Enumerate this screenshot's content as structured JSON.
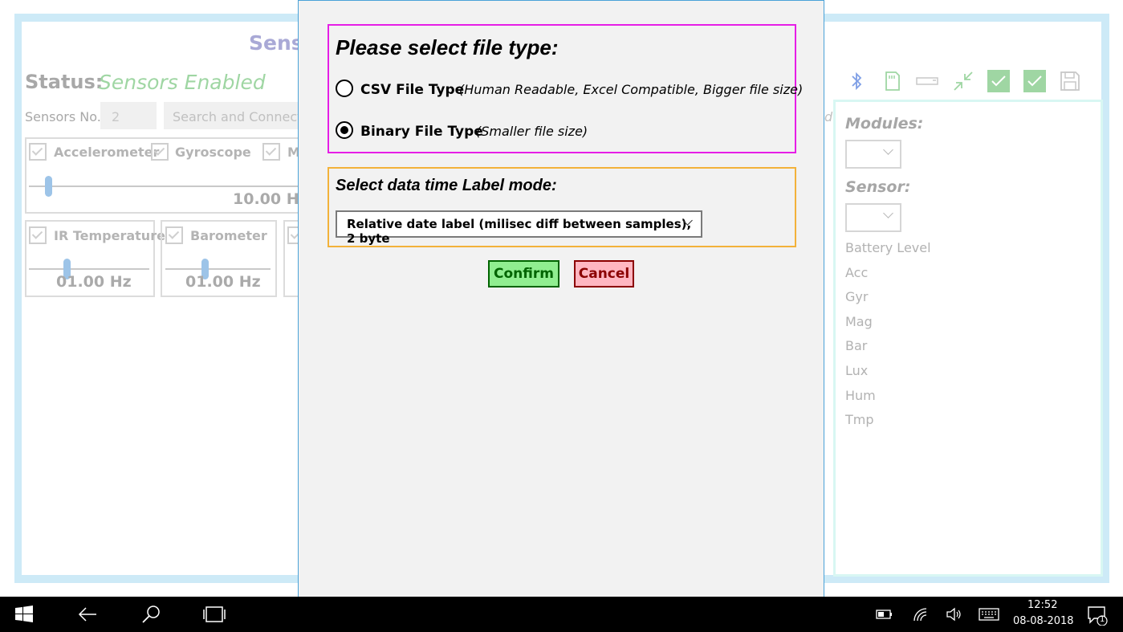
{
  "background": {
    "title_fragment": "Sens",
    "status_label": "Status:",
    "status_value": "Sensors Enabled",
    "sensors_no_label": "Sensors No.",
    "sensors_no_value": "2",
    "search_placeholder": "Search and Connect",
    "partial_d": "d",
    "group1": {
      "items": [
        {
          "label": "Accelerometer"
        },
        {
          "label": "Gyroscope"
        },
        {
          "label": "M"
        }
      ],
      "hz": "10.00 Hz"
    },
    "ir_card": {
      "label": "IR Temperature",
      "hz": "01.00 Hz"
    },
    "baro_card": {
      "label": "Barometer",
      "hz": "01.00 Hz"
    }
  },
  "side_panel": {
    "modules_label": "Modules:",
    "sensor_label": "Sensor:",
    "items": [
      "Battery Level",
      "Acc",
      "Gyr",
      "Mag",
      "Bar",
      "Lux",
      "Hum",
      "Tmp"
    ]
  },
  "toolbar_icons": [
    "bluetooth-icon",
    "sd-card-icon",
    "bar-icon",
    "collapse-icon",
    "check-icon",
    "check-icon",
    "save-icon"
  ],
  "dialog": {
    "file_type_title": "Please select file type:",
    "options": [
      {
        "label": "CSV File Type",
        "desc": "(Human Readable, Excel Compatible, Bigger file size)",
        "selected": false
      },
      {
        "label": "Binary File Type",
        "desc": "(Smaller file size)",
        "selected": true
      }
    ],
    "time_label_title": "Select data time Label mode:",
    "time_label_value": "Relative date label (milisec diff between samples), 2 byte",
    "confirm": "Confirm",
    "cancel": "Cancel"
  },
  "taskbar": {
    "time": "12:52",
    "date": "08-08-2018",
    "notification_count": "1"
  },
  "colors": {
    "accent_magenta": "#e61ee6",
    "accent_orange": "#f3b23a",
    "confirm_bg": "#90ee90",
    "cancel_bg": "#ffb6c1",
    "status_green": "#9fd6a3"
  }
}
